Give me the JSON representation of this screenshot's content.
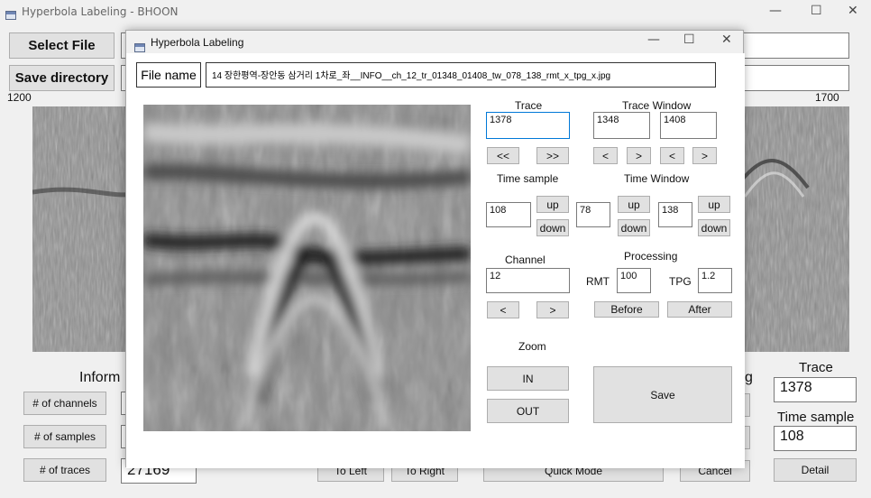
{
  "main": {
    "title": "Hyperbola Labeling - BHOON",
    "select_file": "Select File",
    "save_directory": "Save directory",
    "range_start": "1200",
    "range_end": "1700",
    "information_label": "Inform",
    "partial_label": "g",
    "channels_btn": "# of channels",
    "samples_btn": "# of samples",
    "traces_btn": "# of traces",
    "traces_value": "27169",
    "to_left": "To Left",
    "to_right": "To Right",
    "quick_mode": "Quick Mode",
    "cancel": "Cancel",
    "detail": "Detail",
    "trace_label": "Trace",
    "trace_value": "1378",
    "time_sample_label": "Time sample",
    "time_sample_value": "108"
  },
  "dialog": {
    "title": "Hyperbola Labeling",
    "file_name_label": "File name",
    "file_name_value": "14 장한평역-장안동 삼거리 1차로_좌__INFO__ch_12_tr_01348_01408_tw_078_138_rmt_x_tpg_x.jpg",
    "trace_label": "Trace",
    "trace_value": "1378",
    "trace_window_label": "Trace Window",
    "trace_window_start": "1348",
    "trace_window_end": "1408",
    "prev_fast": "<<",
    "next_fast": ">>",
    "lt": "<",
    "gt": ">",
    "time_sample_label": "Time sample",
    "time_sample_value": "108",
    "up": "up",
    "down": "down",
    "time_window_label": "Time Window",
    "time_window_start": "78",
    "time_window_end": "138",
    "channel_label": "Channel",
    "channel_value": "12",
    "processing_label": "Processing",
    "rmt_label": "RMT",
    "rmt_value": "100",
    "tpg_label": "TPG",
    "tpg_value": "1.2",
    "before": "Before",
    "after": "After",
    "zoom_label": "Zoom",
    "zoom_in": "IN",
    "zoom_out": "OUT",
    "save": "Save"
  },
  "window_controls": {
    "minimize": "—",
    "maximize": "☐",
    "close": "✕"
  }
}
